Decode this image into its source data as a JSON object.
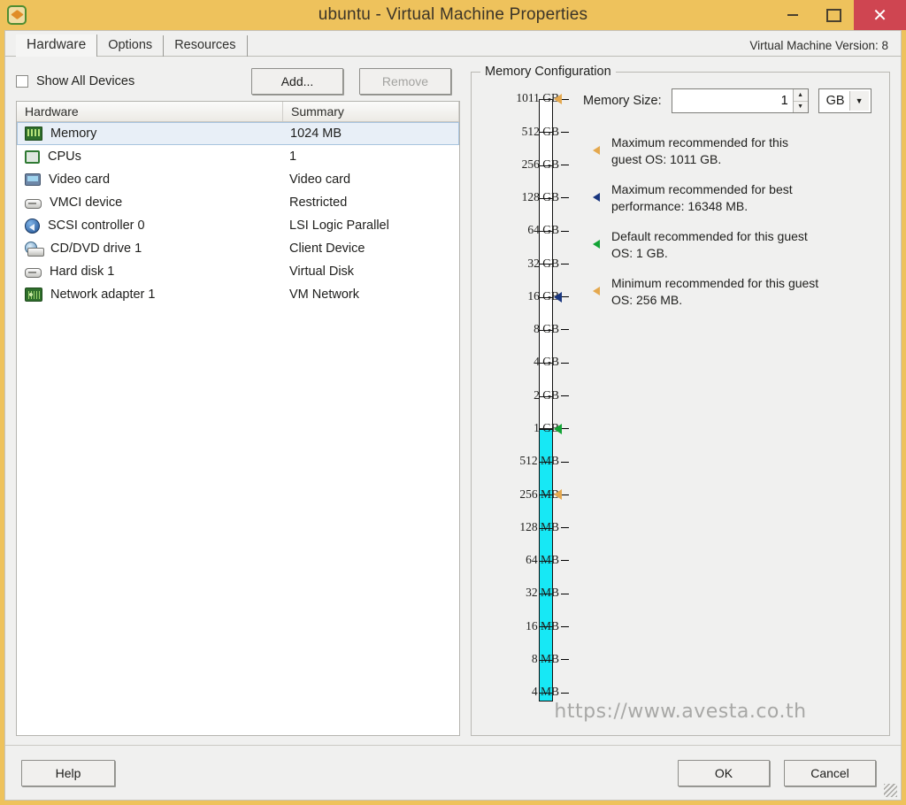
{
  "window": {
    "title": "ubuntu - Virtual Machine Properties",
    "icon": "vm-icon",
    "titlebar_color": "#eec25c",
    "close_color": "#cf4551",
    "controls": {
      "minimize": "minimize-icon",
      "maximize": "maximize-icon",
      "close": "close-icon"
    }
  },
  "tabs": [
    {
      "label": "Hardware",
      "active": true
    },
    {
      "label": "Options",
      "active": false
    },
    {
      "label": "Resources",
      "active": false
    }
  ],
  "vm_version": "Virtual Machine Version: 8",
  "toolbar": {
    "show_all_devices_label": "Show All Devices",
    "show_all_devices_checked": false,
    "add_label": "Add...",
    "remove_label": "Remove",
    "remove_disabled": true
  },
  "hardware_list": {
    "columns": [
      "Hardware",
      "Summary"
    ],
    "selected_index": 0,
    "rows": [
      {
        "icon": "memory-icon",
        "name": "Memory",
        "summary": "1024 MB"
      },
      {
        "icon": "cpu-icon",
        "name": "CPUs",
        "summary": "1"
      },
      {
        "icon": "video-card-icon",
        "name": "Video card",
        "summary": "Video card"
      },
      {
        "icon": "vmci-device-icon",
        "name": "VMCI device",
        "summary": "Restricted"
      },
      {
        "icon": "scsi-controller-icon",
        "name": "SCSI controller 0",
        "summary": "LSI Logic Parallel"
      },
      {
        "icon": "cd-dvd-drive-icon",
        "name": "CD/DVD drive 1",
        "summary": "Client Device"
      },
      {
        "icon": "hard-disk-icon",
        "name": "Hard disk 1",
        "summary": "Virtual Disk"
      },
      {
        "icon": "network-adapter-icon",
        "name": "Network adapter 1",
        "summary": "VM Network"
      }
    ]
  },
  "memory_config": {
    "group_title": "Memory Configuration",
    "memory_size_label": "Memory Size:",
    "memory_size_value": "1",
    "unit_value": "GB",
    "unit_options": [
      "MB",
      "GB"
    ],
    "spinner_up": "▲",
    "spinner_down": "▼",
    "unit_arrow": "▼",
    "notes": [
      {
        "marker_color": "#e4a84e",
        "text": "Maximum recommended for this guest OS: 1011 GB."
      },
      {
        "marker_color": "#19367f",
        "text": "Maximum recommended for best performance: 16348 MB."
      },
      {
        "marker_color": "#12a335",
        "text": "Default recommended for this guest OS: 1 GB."
      },
      {
        "marker_color": "#e4a84e",
        "text": "Minimum recommended for this guest OS: 256 MB."
      }
    ]
  },
  "chart_data": {
    "type": "slider-scale",
    "title": "Memory Configuration",
    "ylabel": "Memory",
    "scale_type": "logarithmic-power-of-two",
    "ticks": [
      "1011 GB",
      "512 GB",
      "256 GB",
      "128 GB",
      "64 GB",
      "32 GB",
      "16 GB",
      "8 GB",
      "4 GB",
      "2 GB",
      "1 GB",
      "512 MB",
      "256 MB",
      "128 MB",
      "64 MB",
      "32 MB",
      "16 MB",
      "8 MB",
      "4 MB"
    ],
    "fill_color": "#17e8f5",
    "fill_from_tick": "1 GB",
    "fill_to_tick": "4 MB",
    "current_value": "1 GB",
    "markers": [
      {
        "at_tick": "1011 GB",
        "color": "#e4a84e",
        "name": "maximum-recommended-guest-os-marker"
      },
      {
        "at_tick": "16 GB",
        "color": "#19367f",
        "name": "maximum-recommended-performance-marker"
      },
      {
        "at_tick": "1 GB",
        "color": "#12a335",
        "name": "default-recommended-marker"
      },
      {
        "at_tick": "256 MB",
        "color": "#e4a84e",
        "name": "minimum-recommended-marker"
      }
    ]
  },
  "watermark": "https://www.avesta.co.th",
  "footer": {
    "help_label": "Help",
    "ok_label": "OK",
    "cancel_label": "Cancel"
  }
}
